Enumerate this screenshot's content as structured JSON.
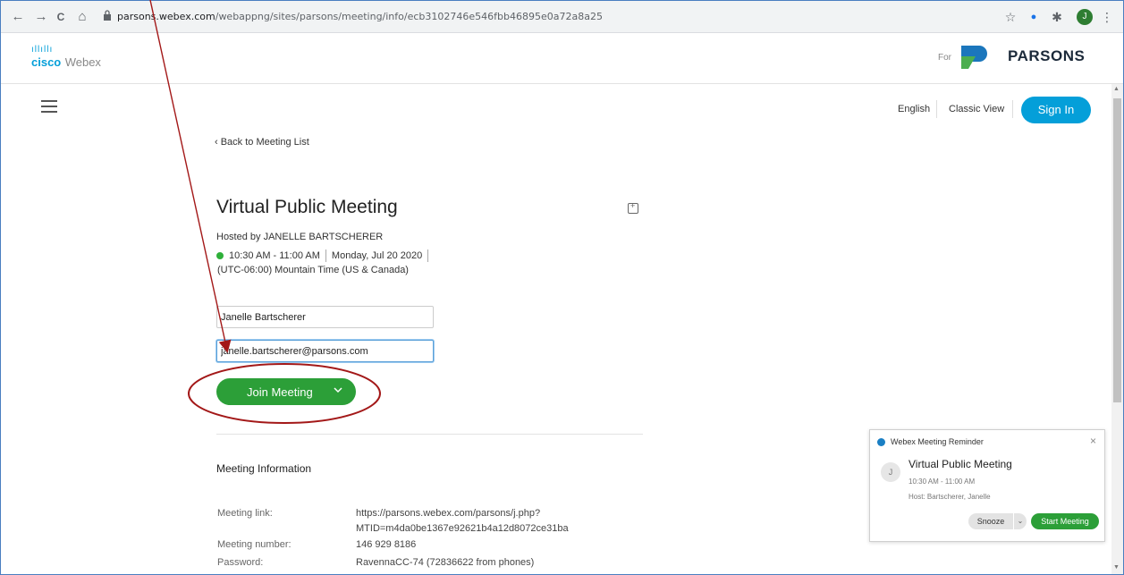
{
  "browser": {
    "url_host": "parsons.webex.com",
    "url_path": "/webappng/sites/parsons/meeting/info/ecb3102746e546fbb46895e0a72a8a25",
    "back_glyph": "←",
    "forward_glyph": "→",
    "reload_glyph": "C",
    "home_glyph": "⌂",
    "star_glyph": "☆",
    "ext1_glyph": "●",
    "ext2_glyph": "✱",
    "profile_initial": "J",
    "menu_glyph": "⋮"
  },
  "header": {
    "cisco_bars": "ıllıllı",
    "cisco_label": "cisco",
    "webex_label": "Webex",
    "for_label": "For",
    "org_name": "PARSONS"
  },
  "topnav": {
    "language": "English",
    "classic_view": "Classic View",
    "sign_in": "Sign In"
  },
  "meeting": {
    "back_link": "‹ Back to Meeting List",
    "title": "Virtual Public Meeting",
    "hosted_by": "Hosted by JANELLE BARTSCHERER",
    "time_range": "10:30 AM - 11:00 AM",
    "date": "Monday, Jul 20 2020",
    "timezone": "(UTC-06:00) Mountain Time (US & Canada)"
  },
  "form": {
    "name_value": "Janelle Bartscherer",
    "email_value": "janelle.bartscherer@parsons.com",
    "join_label": "Join Meeting"
  },
  "info": {
    "section_title": "Meeting Information",
    "link_label": "Meeting link:",
    "link_value_line1": "https://parsons.webex.com/parsons/j.php?",
    "link_value_line2": "MTID=m4da0be1367e92621b4a12d8072ce31ba",
    "number_label": "Meeting number:",
    "number_value": "146 929 8186",
    "password_label": "Password:",
    "password_value": "RavennaCC-74 (72836622 from phones)"
  },
  "reminder": {
    "header": "Webex Meeting Reminder",
    "close_glyph": "×",
    "avatar_initial": "J",
    "title": "Virtual Public Meeting",
    "time": "10:30 AM - 11:00 AM",
    "host": "Host: Bartscherer, Janelle",
    "snooze": "Snooze",
    "snooze_chevron": "⌄",
    "start": "Start Meeting"
  },
  "scrollbar": {
    "up_glyph": "▲",
    "down_glyph": "▼"
  },
  "colors": {
    "accent_blue": "#049fd9",
    "join_green": "#2c9f38",
    "annotation_red": "#a31818"
  }
}
